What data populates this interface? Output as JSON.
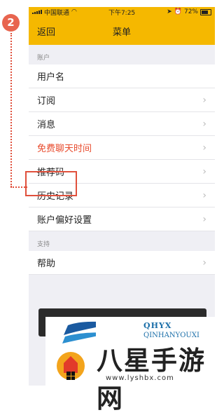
{
  "step_badge": "2",
  "status_bar": {
    "carrier": "中国联通",
    "time": "下午7:25",
    "battery": "72%"
  },
  "nav": {
    "back": "返回",
    "title": "菜单"
  },
  "sections": [
    {
      "header": "账户",
      "items": [
        "用户名",
        "订阅",
        "消息",
        "免费聊天时间",
        "推荐码",
        "历史记录",
        "账户偏好设置"
      ]
    },
    {
      "header": "支持",
      "items": [
        "帮助"
      ]
    }
  ],
  "watermark": {
    "brand": "QHYX",
    "brand_sub": "QINHANYOUXI",
    "title": "八星手游网",
    "url": "www.lyshbx.com"
  },
  "colors": {
    "accent": "#f5b800",
    "highlight": "#e0503c",
    "red_text": "#e84a2c"
  }
}
